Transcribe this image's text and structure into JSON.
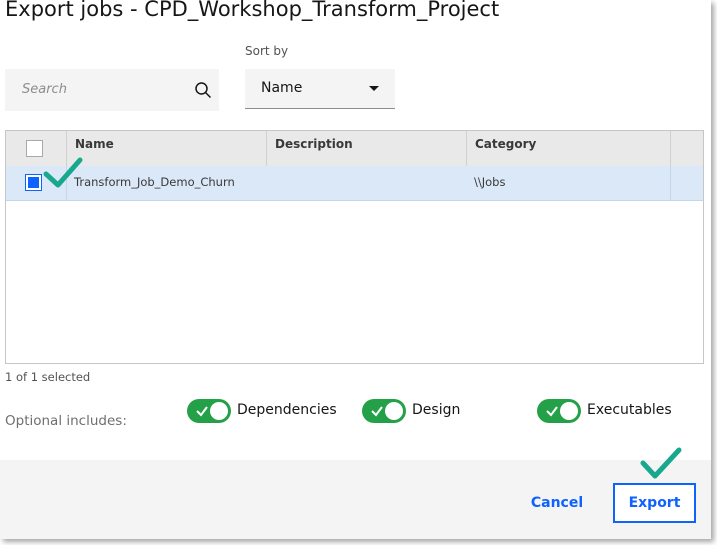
{
  "dialog": {
    "title": "Export jobs - CPD_Workshop_Transform_Project"
  },
  "search": {
    "placeholder": "Search",
    "icon": "search-icon"
  },
  "sort": {
    "label": "Sort by",
    "value": "Name"
  },
  "table": {
    "columns": [
      "Name",
      "Description",
      "Category"
    ],
    "rows": [
      {
        "selected": true,
        "name": "Transform_Job_Demo_Churn",
        "description": "",
        "category": "\\\\Jobs"
      }
    ]
  },
  "selection": {
    "count_text": "1 of 1 selected"
  },
  "options": {
    "label": "Optional includes:",
    "toggles": [
      {
        "label": "Dependencies",
        "on": true
      },
      {
        "label": "Design",
        "on": true
      },
      {
        "label": "Executables",
        "on": true
      }
    ]
  },
  "footer": {
    "cancel_label": "Cancel",
    "export_label": "Export"
  },
  "colors": {
    "accent": "#0f62fe",
    "toggle_on": "#24a148",
    "annotation_check": "#18a88e",
    "selected_row": "#dbe8f7"
  }
}
